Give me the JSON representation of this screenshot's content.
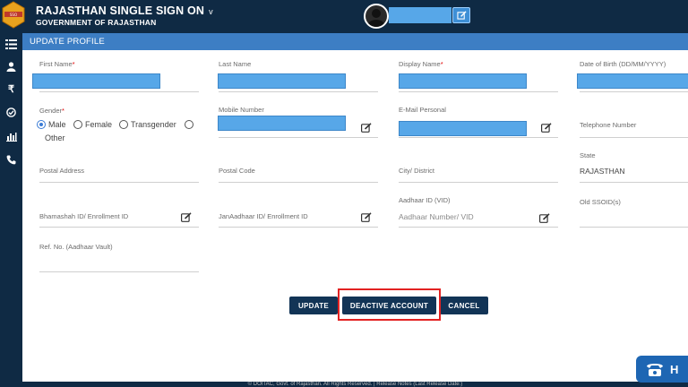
{
  "header": {
    "app_title": "RAJASTHAN SINGLE SIGN ON",
    "app_caret": "v",
    "gov_title": "GOVERNMENT OF RAJASTHAN"
  },
  "sidebar": {
    "icons": [
      "list-icon",
      "user-icon",
      "rupee-icon",
      "check-circle-icon",
      "bar-chart-icon",
      "phone-icon"
    ]
  },
  "panel": {
    "title": "UPDATE PROFILE"
  },
  "form": {
    "first_name_label": "First Name",
    "last_name_label": "Last Name",
    "display_name_label": "Display Name",
    "dob_label": "Date of Birth (DD/MM/YYYY)",
    "required_mark": "*",
    "gender_label": "Gender",
    "gender_options": [
      "Male",
      "Female",
      "Transgender",
      "Other"
    ],
    "gender_selected": "Male",
    "mobile_label": "Mobile Number",
    "email_label": "E-Mail Personal",
    "telephone_label": "Telephone Number",
    "postal_address_label": "Postal Address",
    "postal_code_label": "Postal Code",
    "city_label": "City/ District",
    "state_label": "State",
    "state_value": "RAJASTHAN",
    "bhamashah_label": "Bhamashah ID/ Enrollment ID",
    "janaadhaar_label": "JanAadhaar ID/ Enrollment ID",
    "aadhaar_label": "Aadhaar ID (VID)",
    "aadhaar_placeholder": "Aadhaar Number/ VID",
    "old_ssoid_label": "Old SSOID(s)",
    "ref_no_label": "Ref. No. (Aadhaar Vault)"
  },
  "buttons": {
    "update": "UPDATE",
    "deactivate": "DEACTIVE ACCOUNT",
    "cancel": "CANCEL"
  },
  "footer": {
    "text": "© DOITAC, Govt. of Rajasthan. All Rights Reserved. | Release Notes (Last Release Date:)"
  },
  "help": {
    "label": "H"
  },
  "colors": {
    "header_bg": "#0f2a44",
    "panel_header": "#3d7ec4",
    "button_bg": "#123456",
    "highlight": "#e22222",
    "mask": "#57a7e8"
  }
}
